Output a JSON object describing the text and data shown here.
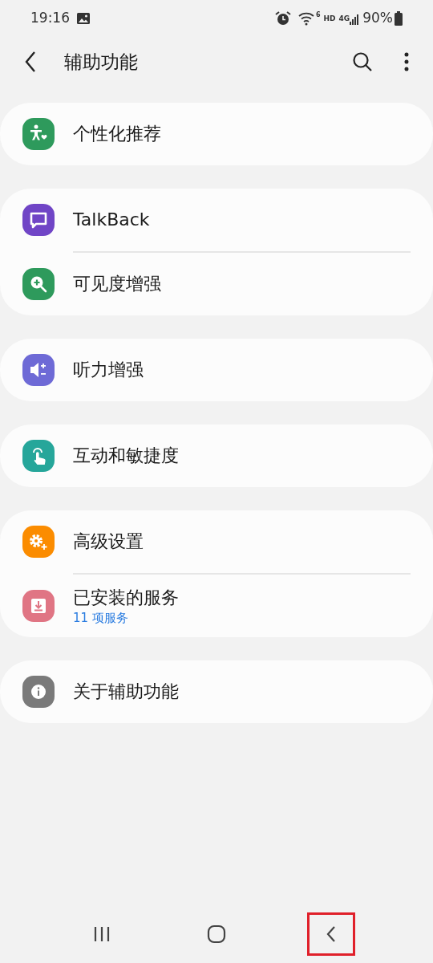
{
  "status_bar": {
    "time": "19:16",
    "wifi_badge": "6",
    "network": [
      "HD",
      "4G"
    ],
    "battery": "90%"
  },
  "header": {
    "title": "辅助功能"
  },
  "groups": [
    {
      "items": [
        {
          "label": "个性化推荐",
          "kind": "person",
          "color": "#2e9a5c"
        }
      ]
    },
    {
      "items": [
        {
          "label": "TalkBack",
          "kind": "chat",
          "color": "#7045c6"
        },
        {
          "label": "可见度增强",
          "kind": "zoom",
          "color": "#2e9a5c"
        }
      ]
    },
    {
      "items": [
        {
          "label": "听力增强",
          "kind": "sound",
          "color": "#6e6ad6"
        }
      ]
    },
    {
      "items": [
        {
          "label": "互动和敏捷度",
          "kind": "touch",
          "color": "#26a69a"
        }
      ]
    },
    {
      "items": [
        {
          "label": "高级设置",
          "kind": "gear",
          "color": "#fb8c00"
        },
        {
          "label": "已安装的服务",
          "kind": "download",
          "color": "#e07584",
          "subtitle": "11 项服务"
        }
      ]
    },
    {
      "items": [
        {
          "label": "关于辅助功能",
          "kind": "info",
          "color": "#7a7a7a"
        }
      ]
    }
  ],
  "nav_bar": [
    {
      "kind": "recents",
      "highlighted": false
    },
    {
      "kind": "home",
      "highlighted": false
    },
    {
      "kind": "back",
      "highlighted": true
    }
  ]
}
